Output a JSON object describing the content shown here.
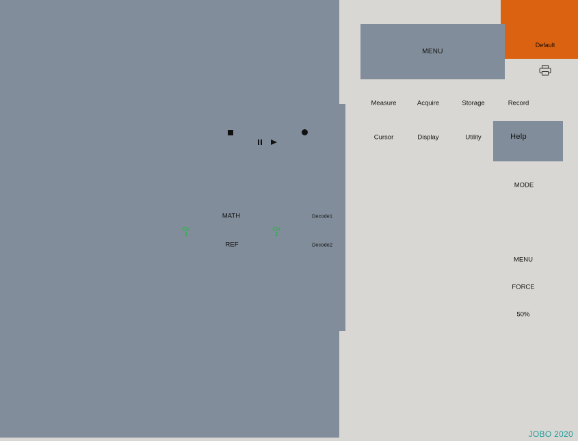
{
  "screen": {
    "transport": {
      "stop_icon": "stop-icon",
      "pause_icon": "pause-icon",
      "play_icon": "play-icon",
      "record_icon": "record-icon"
    },
    "math_label": "MATH",
    "ref_label": "REF",
    "decode1_label": "Decode1",
    "decode2_label": "Decode2",
    "ch1": {
      "top": "CH",
      "num": "1",
      "color": "#2fb54a"
    },
    "ch2": {
      "top": "CH",
      "num": "2",
      "color": "#2fb54a"
    }
  },
  "panel": {
    "menu_label": "MENU",
    "default_label": "Default",
    "default_color": "#db6210",
    "print_icon": "printer-icon",
    "row1": [
      "Measure",
      "Acquire",
      "Storage",
      "Record"
    ],
    "row2": [
      "Cursor",
      "Display",
      "Utility"
    ],
    "help_label": "Help",
    "trigger": {
      "mode_label": "MODE",
      "menu_label": "MENU",
      "force_label": "FORCE",
      "fifty_label": "50%"
    }
  },
  "brand": {
    "text": "JOBO 2020",
    "color": "#239c9b"
  }
}
